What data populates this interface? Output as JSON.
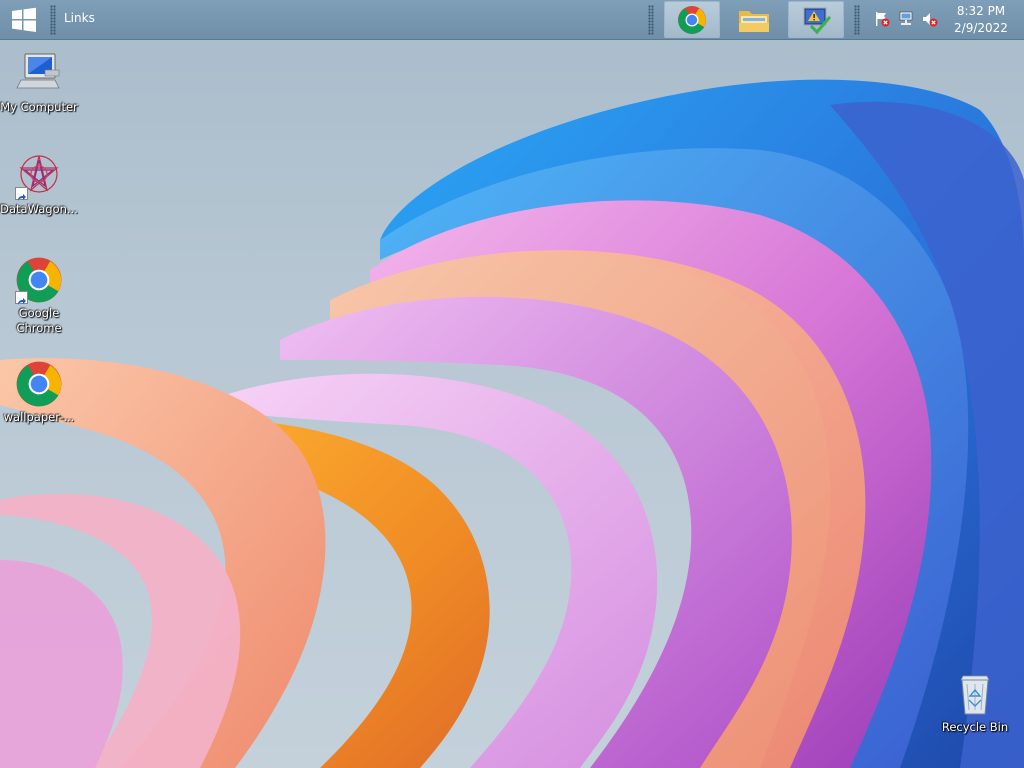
{
  "taskbar": {
    "links_label": "Links",
    "tasks": [
      {
        "icon": "chrome-icon",
        "active": true
      },
      {
        "icon": "file-explorer-icon",
        "active": false
      },
      {
        "icon": "task-monitor-icon",
        "active": true
      }
    ],
    "tray": [
      "action-center-flag-icon",
      "network-icon",
      "speaker-muted-icon"
    ],
    "clock_time": "8:32 PM",
    "clock_date": "2/9/2022"
  },
  "desktop_icons": [
    {
      "label": "My Computer",
      "icon": "computer-icon"
    },
    {
      "label": "DataWagon...",
      "icon": "datawagon-icon",
      "shortcut": true
    },
    {
      "label": "Google Chrome",
      "icon": "chrome-icon",
      "shortcut": true
    },
    {
      "label": "wallpaper-...",
      "icon": "chrome-icon"
    },
    {
      "label": "Recycle Bin",
      "icon": "recycle-bin-icon"
    }
  ],
  "colors": {
    "taskbar": "#7896ae",
    "background": "#b5c5d1",
    "wallpaper_blue": "#2a7bdc",
    "wallpaper_pink": "#e48ad8",
    "wallpaper_orange": "#f6a04a"
  }
}
